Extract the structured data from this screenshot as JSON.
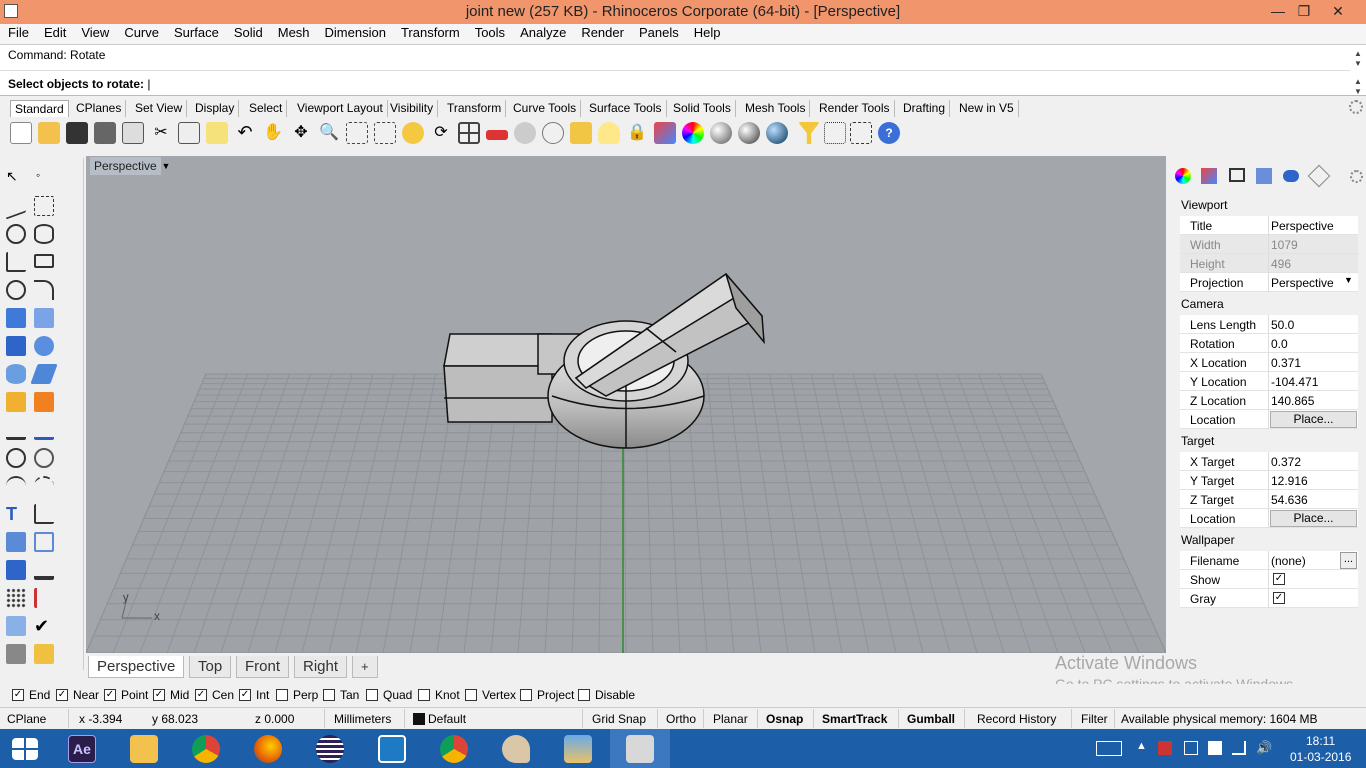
{
  "window": {
    "title": "joint new (257 KB) - Rhinoceros Corporate (64-bit) - [Perspective]",
    "minimize": "—",
    "maximize": "❐",
    "close": "✕"
  },
  "menu": [
    "File",
    "Edit",
    "View",
    "Curve",
    "Surface",
    "Solid",
    "Mesh",
    "Dimension",
    "Transform",
    "Tools",
    "Analyze",
    "Render",
    "Panels",
    "Help"
  ],
  "command": {
    "history": "Command: Rotate",
    "prompt": "Select objects to rotate:"
  },
  "toolbar_tabs": [
    "Standard",
    "CPlanes",
    "Set View",
    "Display",
    "Select",
    "Viewport Layout",
    "Visibility",
    "Transform",
    "Curve Tools",
    "Surface Tools",
    "Solid Tools",
    "Mesh Tools",
    "Render Tools",
    "Drafting",
    "New in V5"
  ],
  "toolbar_icons": [
    "new-icon",
    "open-icon",
    "save-icon",
    "print-icon",
    "import-icon",
    "cut-icon",
    "copy-icon",
    "paste-icon",
    "undo-icon",
    "pan-icon",
    "rotate-view-icon",
    "zoom-dynamic-icon",
    "zoom-window-icon",
    "zoom-extents-icon",
    "zoom-selected-icon",
    "rotate-icon",
    "four-viewports-icon",
    "car-icon",
    "display-mode-icon",
    "cplane-icon",
    "osnap-icon",
    "light-icon",
    "lock-icon",
    "layer-icon",
    "color-icon",
    "shaded-icon",
    "rendered-icon",
    "render-icon",
    "filter-icon",
    "gumball-icon",
    "selection-icon",
    "help-icon"
  ],
  "viewport": {
    "label": "Perspective",
    "axis_x": "x",
    "axis_y": "y",
    "tabs": [
      "Perspective",
      "Top",
      "Front",
      "Right"
    ],
    "add_tab": "+"
  },
  "properties": {
    "viewport_header": "Viewport",
    "title_label": "Title",
    "title_value": "Perspective",
    "width_label": "Width",
    "width_value": "1079",
    "height_label": "Height",
    "height_value": "496",
    "projection_label": "Projection",
    "projection_value": "Perspective",
    "camera_header": "Camera",
    "lens_label": "Lens Length",
    "lens_value": "50.0",
    "rotation_label": "Rotation",
    "rotation_value": "0.0",
    "xloc_label": "X Location",
    "xloc_value": "0.371",
    "yloc_label": "Y Location",
    "yloc_value": "-104.471",
    "zloc_label": "Z Location",
    "zloc_value": "140.865",
    "loc_label": "Location",
    "place_button": "Place...",
    "target_header": "Target",
    "xt_label": "X Target",
    "xt_value": "0.372",
    "yt_label": "Y Target",
    "yt_value": "12.916",
    "zt_label": "Z Target",
    "zt_value": "54.636",
    "tloc_label": "Location",
    "tplace_button": "Place...",
    "wallpaper_header": "Wallpaper",
    "filename_label": "Filename",
    "filename_value": "(none)",
    "browse_button": "...",
    "show_label": "Show",
    "gray_label": "Gray"
  },
  "osnaps": [
    {
      "label": "End",
      "checked": true
    },
    {
      "label": "Near",
      "checked": true
    },
    {
      "label": "Point",
      "checked": true
    },
    {
      "label": "Mid",
      "checked": true
    },
    {
      "label": "Cen",
      "checked": true
    },
    {
      "label": "Int",
      "checked": true
    },
    {
      "label": "Perp",
      "checked": false
    },
    {
      "label": "Tan",
      "checked": false
    },
    {
      "label": "Quad",
      "checked": false
    },
    {
      "label": "Knot",
      "checked": false
    },
    {
      "label": "Vertex",
      "checked": false
    },
    {
      "label": "Project",
      "checked": false
    },
    {
      "label": "Disable",
      "checked": false
    }
  ],
  "status": {
    "cplane": "CPlane",
    "x": "x -3.394",
    "y": "y 68.023",
    "z": "z 0.000",
    "units": "Millimeters",
    "layer": "Default",
    "grid_snap": "Grid Snap",
    "ortho": "Ortho",
    "planar": "Planar",
    "osnap": "Osnap",
    "smarttrack": "SmartTrack",
    "gumball": "Gumball",
    "record_history": "Record History",
    "filter": "Filter",
    "memory": "Available physical memory: 1604 MB"
  },
  "watermark": {
    "line1": "Activate Windows",
    "line2": "Go to PC settings to activate Windows."
  },
  "taskbar": {
    "time": "18:11",
    "date": "01-03-2016",
    "apps": [
      "windows-start-icon",
      "after-effects-icon",
      "file-explorer-icon",
      "chrome-icon",
      "firefox-icon",
      "eclipse-icon",
      "app-icon",
      "chrome-icon",
      "paint-icon",
      "photos-icon",
      "rhino-icon"
    ]
  },
  "colors": {
    "titlebar": "#f0956c",
    "viewport_bg": "#a3a7ac",
    "taskbar": "#1c5ea8"
  }
}
